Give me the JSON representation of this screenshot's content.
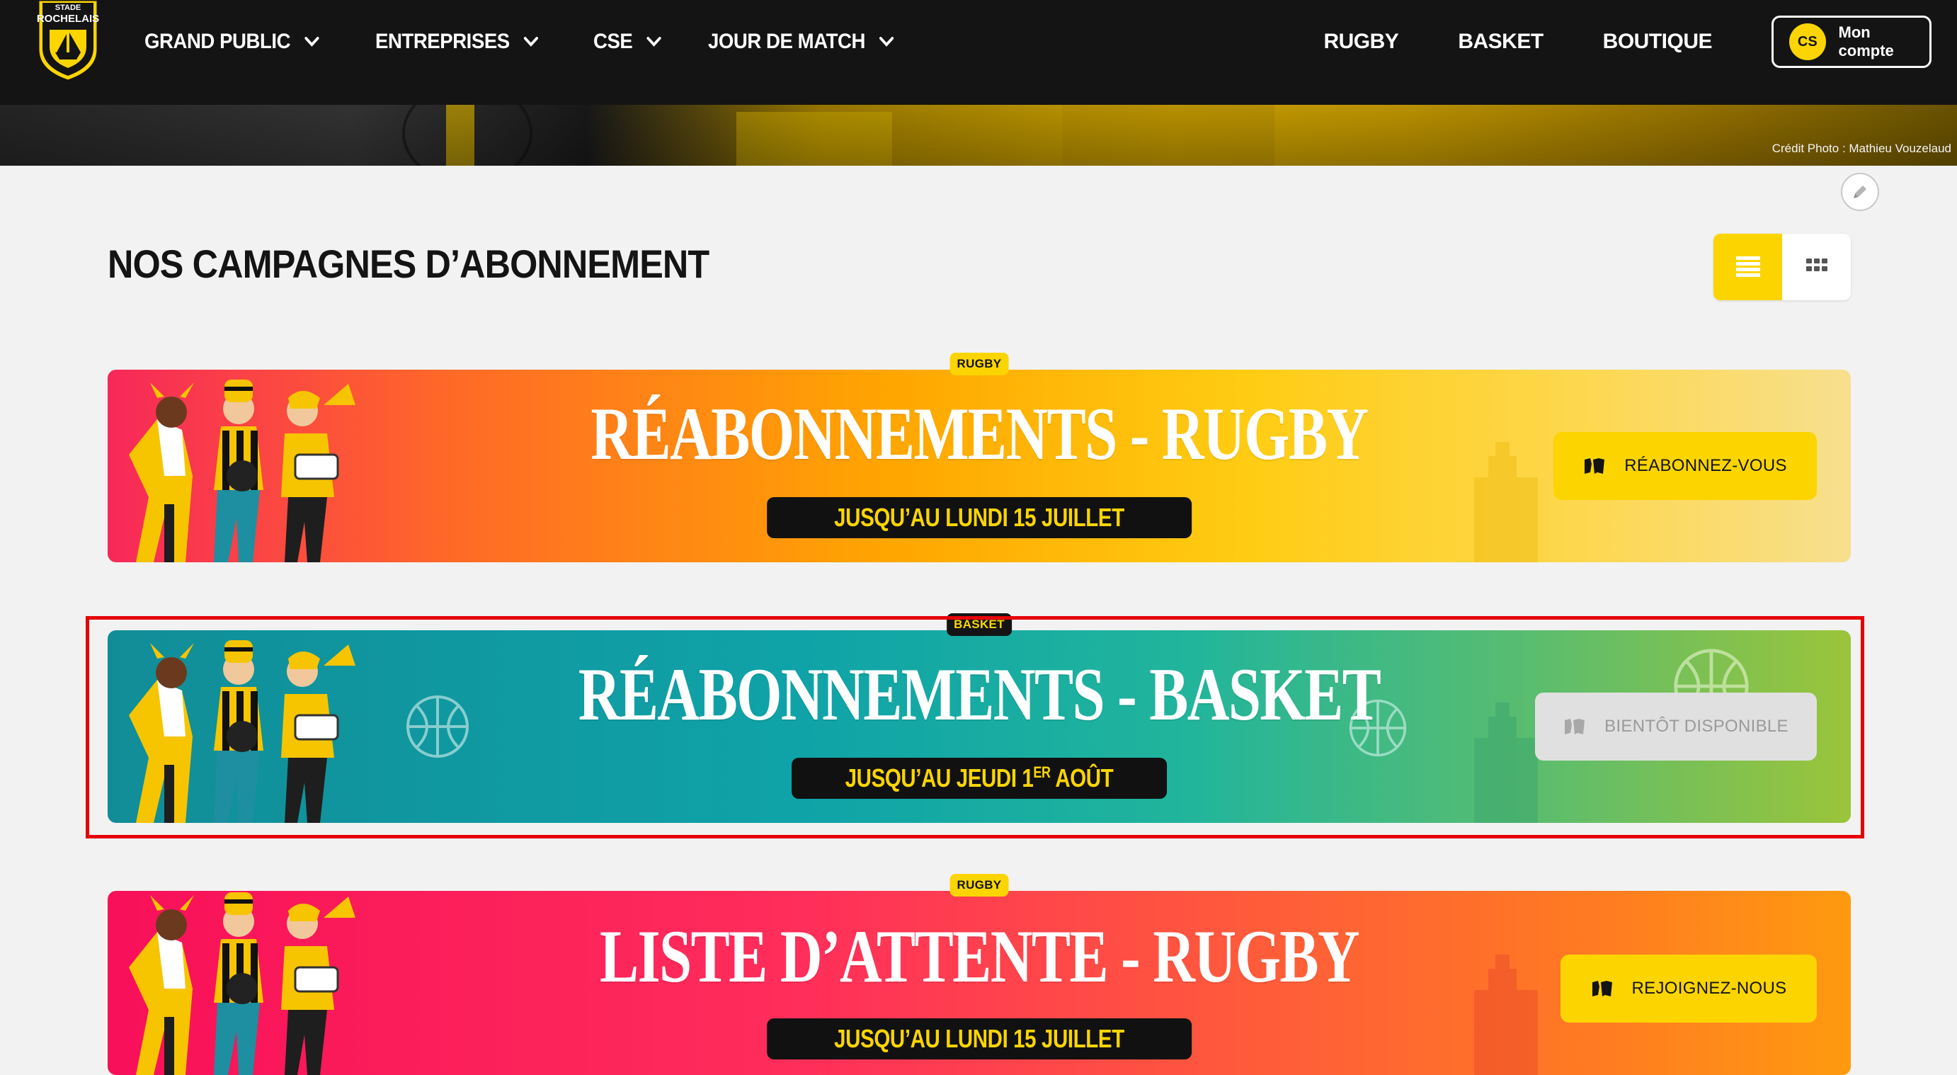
{
  "header": {
    "logo": {
      "line1": "STADE",
      "line2": "ROCHELAIS"
    },
    "menu": [
      {
        "label": "GRAND PUBLIC"
      },
      {
        "label": "ENTREPRISES"
      },
      {
        "label": "CSE"
      },
      {
        "label": "JOUR DE MATCH"
      }
    ],
    "links": [
      {
        "label": "RUGBY"
      },
      {
        "label": "BASKET"
      },
      {
        "label": "BOUTIQUE"
      }
    ],
    "account": {
      "initials": "CS",
      "label": "Mon compte"
    }
  },
  "hero": {
    "credit": "Crédit Photo : Mathieu Vouzelaud"
  },
  "main": {
    "title": "NOS CAMPAGNES D’ABONNEMENT",
    "view_toggle": {
      "active": "list",
      "icons": [
        "list-view-icon",
        "grid-view-icon"
      ]
    },
    "campaigns": [
      {
        "tag": "RUGBY",
        "title": "RÉABONNEMENTS - RUGBY",
        "subtitle": "JUSQU’AU LUNDI 15 JUILLET",
        "cta": "RÉABONNEZ-VOUS",
        "cta_state": "enabled"
      },
      {
        "tag": "BASKET",
        "title": "RÉABONNEMENTS - BASKET",
        "subtitle_pre": "JUSQU’AU JEUDI 1",
        "subtitle_sup": "ER",
        "subtitle_post": " AOÛT",
        "cta": "BIENTÔT DISPONIBLE",
        "cta_state": "disabled"
      },
      {
        "tag": "RUGBY",
        "title": "LISTE D’ATTENTE - RUGBY",
        "subtitle": "JUSQU’AU LUNDI 15 JUILLET",
        "cta": "REJOIGNEZ-NOUS",
        "cta_state": "enabled"
      }
    ]
  },
  "colors": {
    "brand_yellow": "#fcd500",
    "nav_bg": "#141414",
    "page_bg": "#f2f2f2",
    "highlight": "#e60000"
  }
}
